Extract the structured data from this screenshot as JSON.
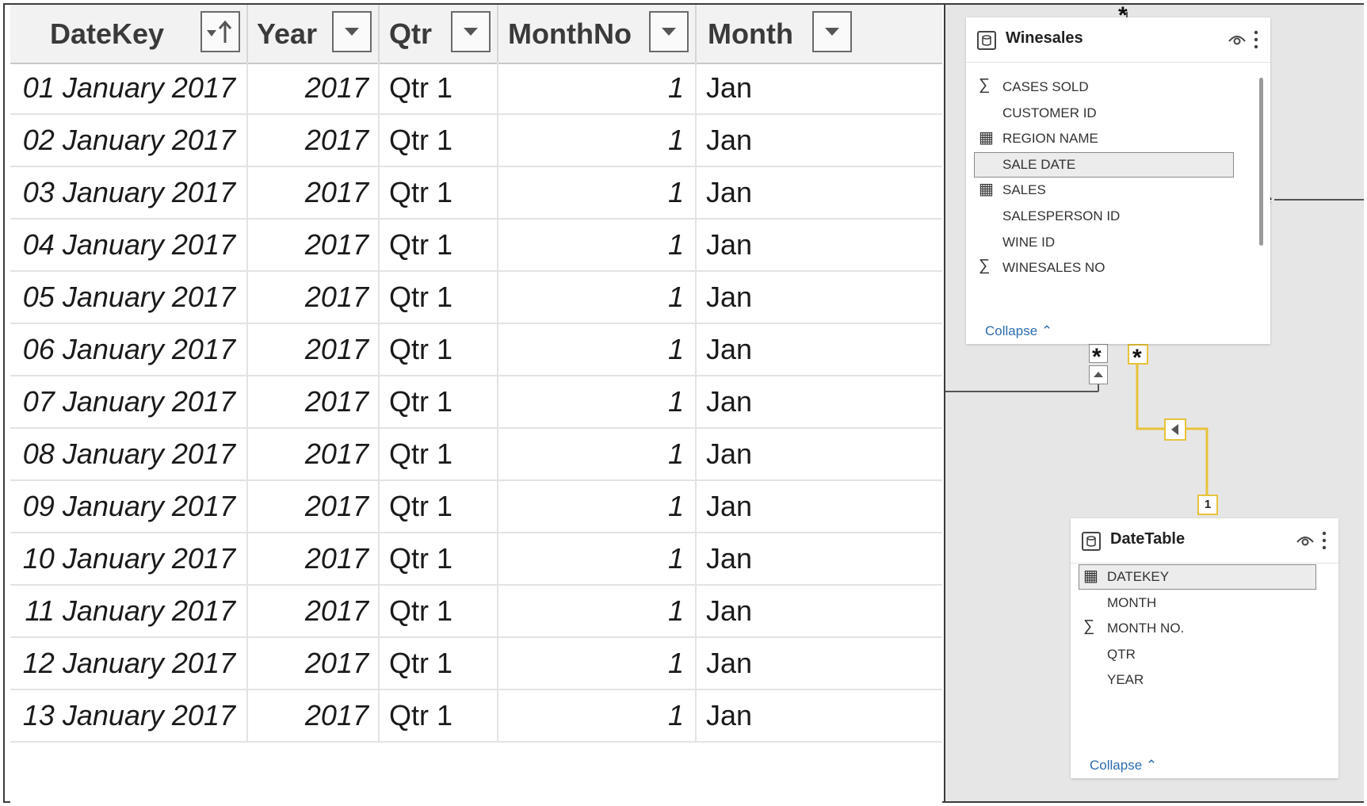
{
  "grid": {
    "columns": [
      {
        "label": "DateKey",
        "filter_icon": "sort-ascending-icon"
      },
      {
        "label": "Year",
        "filter_icon": "dropdown-icon"
      },
      {
        "label": "Qtr",
        "filter_icon": "dropdown-icon"
      },
      {
        "label": "MonthNo",
        "filter_icon": "dropdown-icon"
      },
      {
        "label": "Month",
        "filter_icon": "dropdown-icon"
      }
    ],
    "rows": [
      [
        "01 January 2017",
        "2017",
        "Qtr 1",
        "1",
        "Jan"
      ],
      [
        "02 January 2017",
        "2017",
        "Qtr 1",
        "1",
        "Jan"
      ],
      [
        "03 January 2017",
        "2017",
        "Qtr 1",
        "1",
        "Jan"
      ],
      [
        "04 January 2017",
        "2017",
        "Qtr 1",
        "1",
        "Jan"
      ],
      [
        "05 January 2017",
        "2017",
        "Qtr 1",
        "1",
        "Jan"
      ],
      [
        "06 January 2017",
        "2017",
        "Qtr 1",
        "1",
        "Jan"
      ],
      [
        "07 January 2017",
        "2017",
        "Qtr 1",
        "1",
        "Jan"
      ],
      [
        "08 January 2017",
        "2017",
        "Qtr 1",
        "1",
        "Jan"
      ],
      [
        "09 January 2017",
        "2017",
        "Qtr 1",
        "1",
        "Jan"
      ],
      [
        "10 January 2017",
        "2017",
        "Qtr 1",
        "1",
        "Jan"
      ],
      [
        "11 January 2017",
        "2017",
        "Qtr 1",
        "1",
        "Jan"
      ],
      [
        "12 January 2017",
        "2017",
        "Qtr 1",
        "1",
        "Jan"
      ],
      [
        "13 January 2017",
        "2017",
        "Qtr 1",
        "1",
        "Jan"
      ]
    ]
  },
  "diagram": {
    "winesales": {
      "title": "Winesales",
      "icon": "table-icon",
      "fields": [
        {
          "name": "CASES SOLD",
          "icon": "sigma-icon"
        },
        {
          "name": "CUSTOMER ID",
          "icon": ""
        },
        {
          "name": "REGION NAME",
          "icon": "calculated-column-icon"
        },
        {
          "name": "SALE DATE",
          "icon": "",
          "selected": true
        },
        {
          "name": "SALES",
          "icon": "measure-icon"
        },
        {
          "name": "SALESPERSON ID",
          "icon": ""
        },
        {
          "name": "WINE ID",
          "icon": ""
        },
        {
          "name": "WINESALES NO",
          "icon": "sigma-icon"
        }
      ],
      "collapse_label": "Collapse"
    },
    "datetable": {
      "title": "DateTable",
      "icon": "table-icon",
      "fields": [
        {
          "name": "DATEKEY",
          "icon": "calendar-icon",
          "selected": true
        },
        {
          "name": "MONTH",
          "icon": ""
        },
        {
          "name": "MONTH NO.",
          "icon": "sigma-icon"
        },
        {
          "name": "QTR",
          "icon": ""
        },
        {
          "name": "YEAR",
          "icon": ""
        }
      ],
      "collapse_label": "Collapse"
    },
    "relationship": {
      "many_marker": "*",
      "one_marker": "1",
      "highlight_color": "#e8c23a"
    }
  }
}
